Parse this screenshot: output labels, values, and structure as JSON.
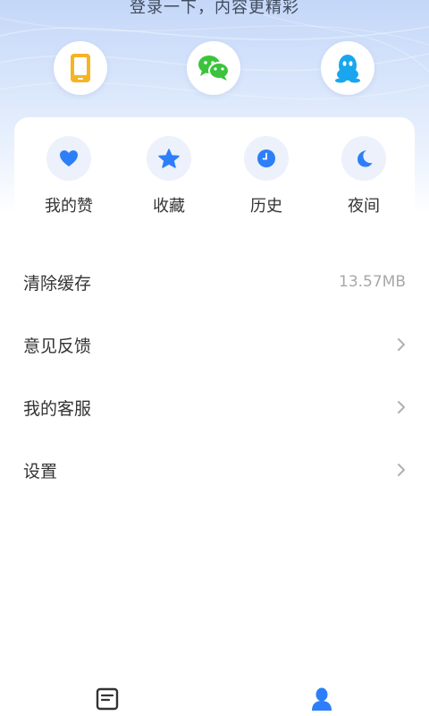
{
  "header": {
    "login_hint": "登录一下，内容更精彩"
  },
  "login_options": [
    {
      "icon": "phone-icon",
      "color": "#f7b422"
    },
    {
      "icon": "wechat-icon",
      "color": "#3cc33c"
    },
    {
      "icon": "qq-icon",
      "color": "#1aa6ef"
    }
  ],
  "quick_actions": [
    {
      "label": "我的赞",
      "icon": "heart-icon"
    },
    {
      "label": "收藏",
      "icon": "star-icon"
    },
    {
      "label": "历史",
      "icon": "clock-icon"
    },
    {
      "label": "夜间",
      "icon": "moon-icon"
    }
  ],
  "menu": {
    "clear_cache": {
      "label": "清除缓存",
      "value": "13.57MB"
    },
    "feedback": {
      "label": "意见反馈"
    },
    "customer_service": {
      "label": "我的客服"
    },
    "settings": {
      "label": "设置"
    }
  },
  "colors": {
    "accent": "#2d7ff9",
    "text": "#333333",
    "muted": "#a8a8a8"
  },
  "tabbar": [
    {
      "icon": "article-icon",
      "active": false
    },
    {
      "icon": "profile-icon",
      "active": true
    }
  ]
}
